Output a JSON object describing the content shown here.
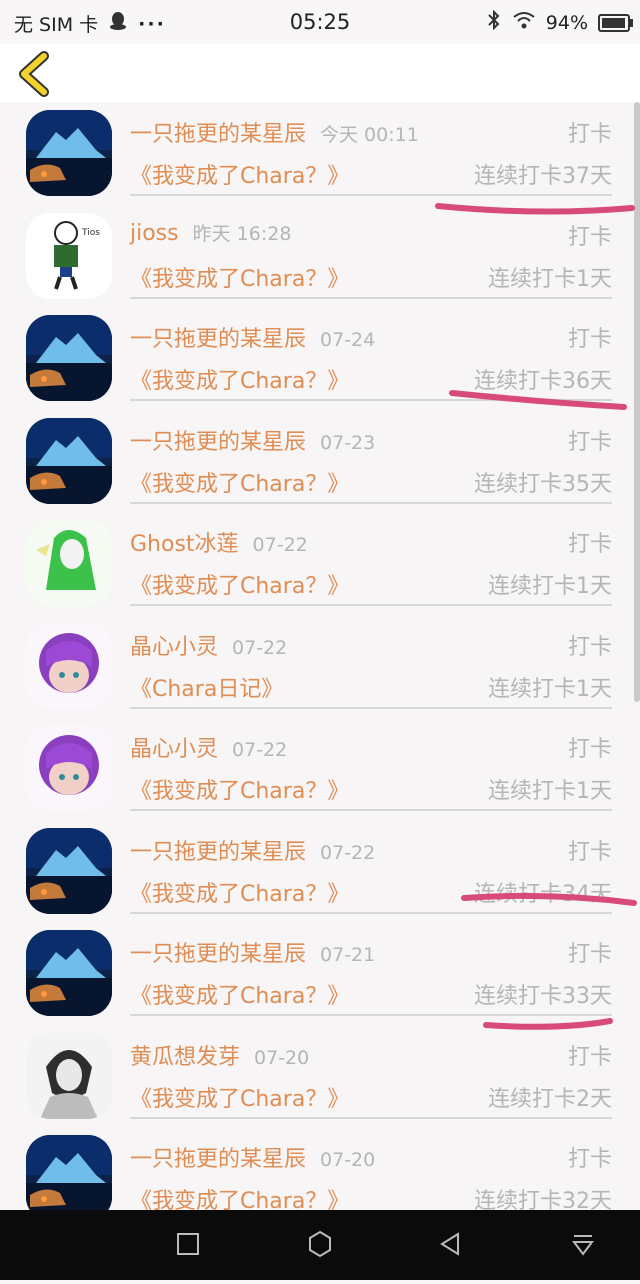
{
  "status_bar": {
    "sim": "无 SIM 卡",
    "time": "05:25",
    "battery": "94%",
    "battery_level": 0.94
  },
  "header": {
    "back_icon": "chevron-left-icon"
  },
  "rows": [
    {
      "name": "一只拖更的某星辰",
      "time": "今天 00:11",
      "action": "打卡",
      "book": "《我变成了Chara？》",
      "streak": "连续打卡37天",
      "avatar": "landscape"
    },
    {
      "name": "jioss",
      "time": "昨天 16:28",
      "action": "打卡",
      "book": "《我变成了Chara？》",
      "streak": "连续打卡1天",
      "avatar": "sans"
    },
    {
      "name": "一只拖更的某星辰",
      "time": "07-24",
      "action": "打卡",
      "book": "《我变成了Chara？》",
      "streak": "连续打卡36天",
      "avatar": "landscape"
    },
    {
      "name": "一只拖更的某星辰",
      "time": "07-23",
      "action": "打卡",
      "book": "《我变成了Chara？》",
      "streak": "连续打卡35天",
      "avatar": "landscape"
    },
    {
      "name": "Ghost冰莲",
      "time": "07-22",
      "action": "打卡",
      "book": "《我变成了Chara？》",
      "streak": "连续打卡1天",
      "avatar": "ghost"
    },
    {
      "name": "晶心小灵",
      "time": "07-22",
      "action": "打卡",
      "book": "《Chara日记》",
      "streak": "连续打卡1天",
      "avatar": "purple"
    },
    {
      "name": "晶心小灵",
      "time": "07-22",
      "action": "打卡",
      "book": "《我变成了Chara？》",
      "streak": "连续打卡1天",
      "avatar": "purple"
    },
    {
      "name": "一只拖更的某星辰",
      "time": "07-22",
      "action": "打卡",
      "book": "《我变成了Chara？》",
      "streak": "连续打卡34天",
      "avatar": "landscape"
    },
    {
      "name": "一只拖更的某星辰",
      "time": "07-21",
      "action": "打卡",
      "book": "《我变成了Chara？》",
      "streak": "连续打卡33天",
      "avatar": "landscape"
    },
    {
      "name": "黄瓜想发芽",
      "time": "07-20",
      "action": "打卡",
      "book": "《我变成了Chara？》",
      "streak": "连续打卡2天",
      "avatar": "sketch"
    },
    {
      "name": "一只拖更的某星辰",
      "time": "07-20",
      "action": "打卡",
      "book": "《我变成了Chara？》",
      "streak": "连续打卡32天",
      "avatar": "landscape"
    }
  ],
  "colors": {
    "accent": "#e08d53",
    "muted": "#b5b5b5",
    "annotation": "#d84b79"
  },
  "nav": {
    "icons": [
      "square-icon",
      "hexagon-home-icon",
      "triangle-back-icon",
      "download-icon"
    ]
  }
}
